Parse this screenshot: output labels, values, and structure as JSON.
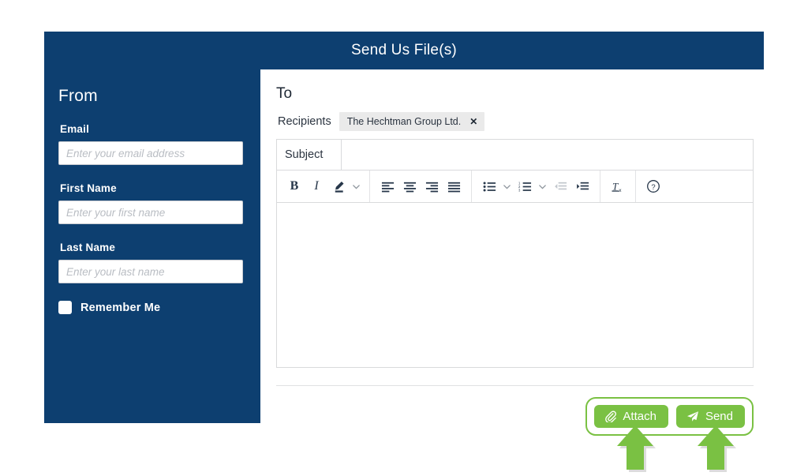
{
  "window": {
    "title": "Send Us File(s)"
  },
  "colors": {
    "navy": "#0d3f70",
    "green": "#7ac143",
    "chip_bg": "#eaeaea",
    "border": "#d9dadc"
  },
  "sidebar": {
    "heading": "From",
    "fields": [
      {
        "label": "Email",
        "value": "",
        "placeholder": "Enter your email address"
      },
      {
        "label": "First Name",
        "value": "",
        "placeholder": "Enter your first name"
      },
      {
        "label": "Last Name",
        "value": "",
        "placeholder": "Enter your last name"
      }
    ],
    "remember": {
      "label": "Remember Me",
      "checked": false
    }
  },
  "main": {
    "heading": "To",
    "recipients": {
      "label": "Recipients",
      "chips": [
        {
          "name": "The Hechtman Group Ltd.",
          "remove": "✕"
        }
      ]
    },
    "subject": {
      "label": "Subject",
      "value": "",
      "placeholder": ""
    },
    "toolbar": {
      "groups": [
        {
          "items": [
            {
              "icon": "bold-icon",
              "label": "B",
              "disabled": false
            },
            {
              "icon": "italic-icon",
              "label": "I",
              "disabled": false
            },
            {
              "icon": "text-color-pen-icon",
              "label": "",
              "disabled": false
            },
            {
              "icon": "chevron-down-icon",
              "label": "",
              "disabled": false
            }
          ]
        },
        {
          "items": [
            {
              "icon": "align-left-icon",
              "label": "",
              "disabled": false
            },
            {
              "icon": "align-center-icon",
              "label": "",
              "disabled": false
            },
            {
              "icon": "align-right-icon",
              "label": "",
              "disabled": false
            },
            {
              "icon": "align-justify-icon",
              "label": "",
              "disabled": false
            }
          ]
        },
        {
          "items": [
            {
              "icon": "bulleted-list-icon",
              "label": "",
              "disabled": false
            },
            {
              "icon": "chevron-down-icon",
              "label": "",
              "disabled": false
            },
            {
              "icon": "numbered-list-icon",
              "label": "",
              "disabled": false
            },
            {
              "icon": "chevron-down-icon",
              "label": "",
              "disabled": false
            },
            {
              "icon": "outdent-icon",
              "label": "",
              "disabled": true
            },
            {
              "icon": "indent-icon",
              "label": "",
              "disabled": false
            }
          ]
        },
        {
          "items": [
            {
              "icon": "clear-formatting-icon",
              "label": "",
              "disabled": false
            }
          ]
        },
        {
          "items": [
            {
              "icon": "help-circle-icon",
              "label": "",
              "disabled": false
            }
          ]
        }
      ]
    },
    "editor": {
      "value": ""
    },
    "actions": {
      "attach": {
        "label": "Attach",
        "icon": "paperclip-icon"
      },
      "send": {
        "label": "Send",
        "icon": "paper-plane-icon"
      }
    }
  },
  "annotations": [
    {
      "name": "arrow-pointing-at-attach",
      "direction": "up"
    },
    {
      "name": "arrow-pointing-at-send",
      "direction": "up"
    }
  ]
}
